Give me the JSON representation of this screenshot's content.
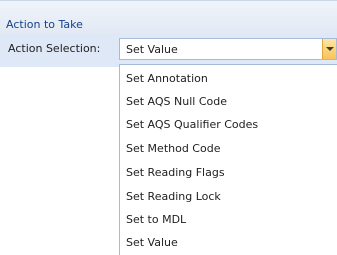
{
  "group": {
    "title": "Action to Take"
  },
  "action_row": {
    "label": "Action Selection:",
    "selected_value": "Set Value",
    "button_icon": "chevron-down-icon"
  },
  "dropdown": {
    "items": [
      "Set Annotation",
      "Set AQS Null Code",
      "Set AQS Qualifier Codes",
      "Set Method Code",
      "Set Reading Flags",
      "Set Reading Lock",
      "Set to MDL",
      "Set Value"
    ]
  },
  "colors": {
    "header_text": "#15428b",
    "row_background": "#dfe8f6",
    "combo_border": "#a7bad9",
    "dropdown_button": "#f7c35b"
  }
}
